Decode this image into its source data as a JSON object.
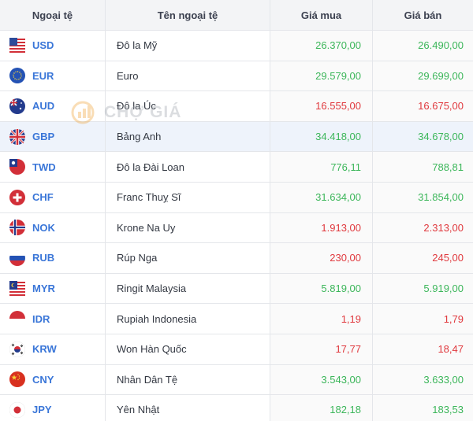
{
  "header": {
    "col_code": "Ngoại tệ",
    "col_name": "Tên ngoại tệ",
    "col_buy": "Giá mua",
    "col_sell": "Giá bán"
  },
  "watermark": "CHỢ GIÁ",
  "rows": [
    {
      "code": "USD",
      "name": "Đô la Mỹ",
      "buy": "26.370,00",
      "sell": "26.490,00",
      "trend": "up",
      "flag": "us-flag-icon"
    },
    {
      "code": "EUR",
      "name": "Euro",
      "buy": "29.579,00",
      "sell": "29.699,00",
      "trend": "up",
      "flag": "eu-flag-icon"
    },
    {
      "code": "AUD",
      "name": "Đô la Úc",
      "buy": "16.555,00",
      "sell": "16.675,00",
      "trend": "down",
      "flag": "au-flag-icon"
    },
    {
      "code": "GBP",
      "name": "Bảng Anh",
      "buy": "34.418,00",
      "sell": "34.678,00",
      "trend": "up",
      "flag": "gb-flag-icon"
    },
    {
      "code": "TWD",
      "name": "Đô la Đài Loan",
      "buy": "776,11",
      "sell": "788,81",
      "trend": "up",
      "flag": "tw-flag-icon"
    },
    {
      "code": "CHF",
      "name": "Franc Thuỵ Sĩ",
      "buy": "31.634,00",
      "sell": "31.854,00",
      "trend": "up",
      "flag": "ch-flag-icon"
    },
    {
      "code": "NOK",
      "name": "Krone Na Uy",
      "buy": "1.913,00",
      "sell": "2.313,00",
      "trend": "down",
      "flag": "no-flag-icon"
    },
    {
      "code": "RUB",
      "name": "Rúp Nga",
      "buy": "230,00",
      "sell": "245,00",
      "trend": "down",
      "flag": "ru-flag-icon"
    },
    {
      "code": "MYR",
      "name": "Ringit Malaysia",
      "buy": "5.819,00",
      "sell": "5.919,00",
      "trend": "up",
      "flag": "my-flag-icon"
    },
    {
      "code": "IDR",
      "name": "Rupiah Indonesia",
      "buy": "1,19",
      "sell": "1,79",
      "trend": "down",
      "flag": "id-flag-icon"
    },
    {
      "code": "KRW",
      "name": "Won Hàn Quốc",
      "buy": "17,77",
      "sell": "18,47",
      "trend": "down",
      "flag": "kr-flag-icon"
    },
    {
      "code": "CNY",
      "name": "Nhân Dân Tệ",
      "buy": "3.543,00",
      "sell": "3.633,00",
      "trend": "up",
      "flag": "cn-flag-icon"
    },
    {
      "code": "JPY",
      "name": "Yên Nhật",
      "buy": "182,18",
      "sell": "183,53",
      "trend": "up",
      "flag": "jp-flag-icon"
    }
  ],
  "colors": {
    "up": "#3cb65a",
    "down": "#e0393e",
    "code": "#3a76d8",
    "header_bg": "#f3f4f6",
    "highlight_bg": "#eef3fb"
  }
}
